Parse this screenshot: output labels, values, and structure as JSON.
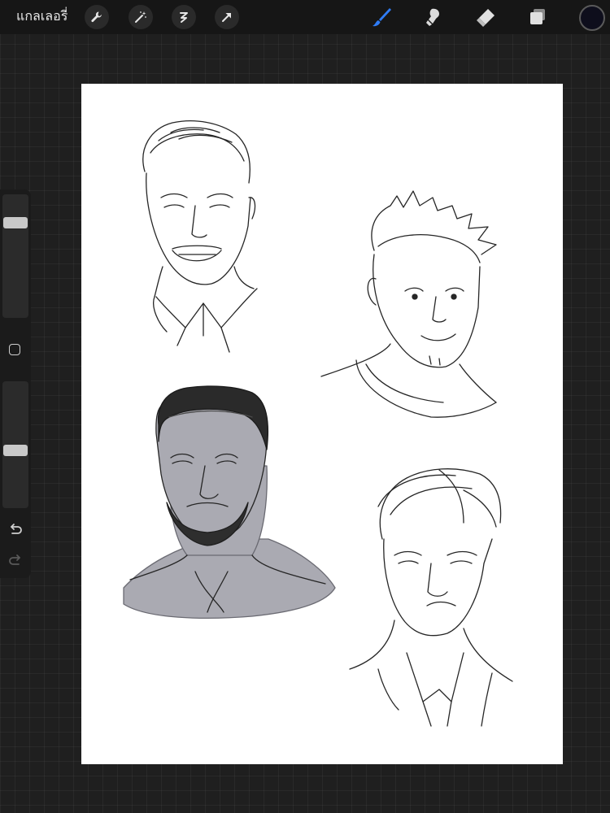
{
  "toolbar": {
    "gallery_label": "แกลเลอรี่",
    "left_icons": [
      "wrench-icon",
      "magic-wand-icon",
      "selection-icon",
      "transform-arrow-icon"
    ],
    "right_tools": [
      "brush-icon",
      "smudge-icon",
      "eraser-icon",
      "layers-icon"
    ],
    "active_tool": "brush-icon"
  },
  "colors": {
    "active_tool": "#2f7cf6",
    "current_color": "#0e0e1c",
    "canvas": "#ffffff",
    "shading_gray": "#aaaab2"
  },
  "sidebar": {
    "brush_size_level": 0.2,
    "opacity_level": 0.55,
    "icons": [
      "modify-square-icon",
      "undo-icon",
      "redo-icon"
    ]
  }
}
